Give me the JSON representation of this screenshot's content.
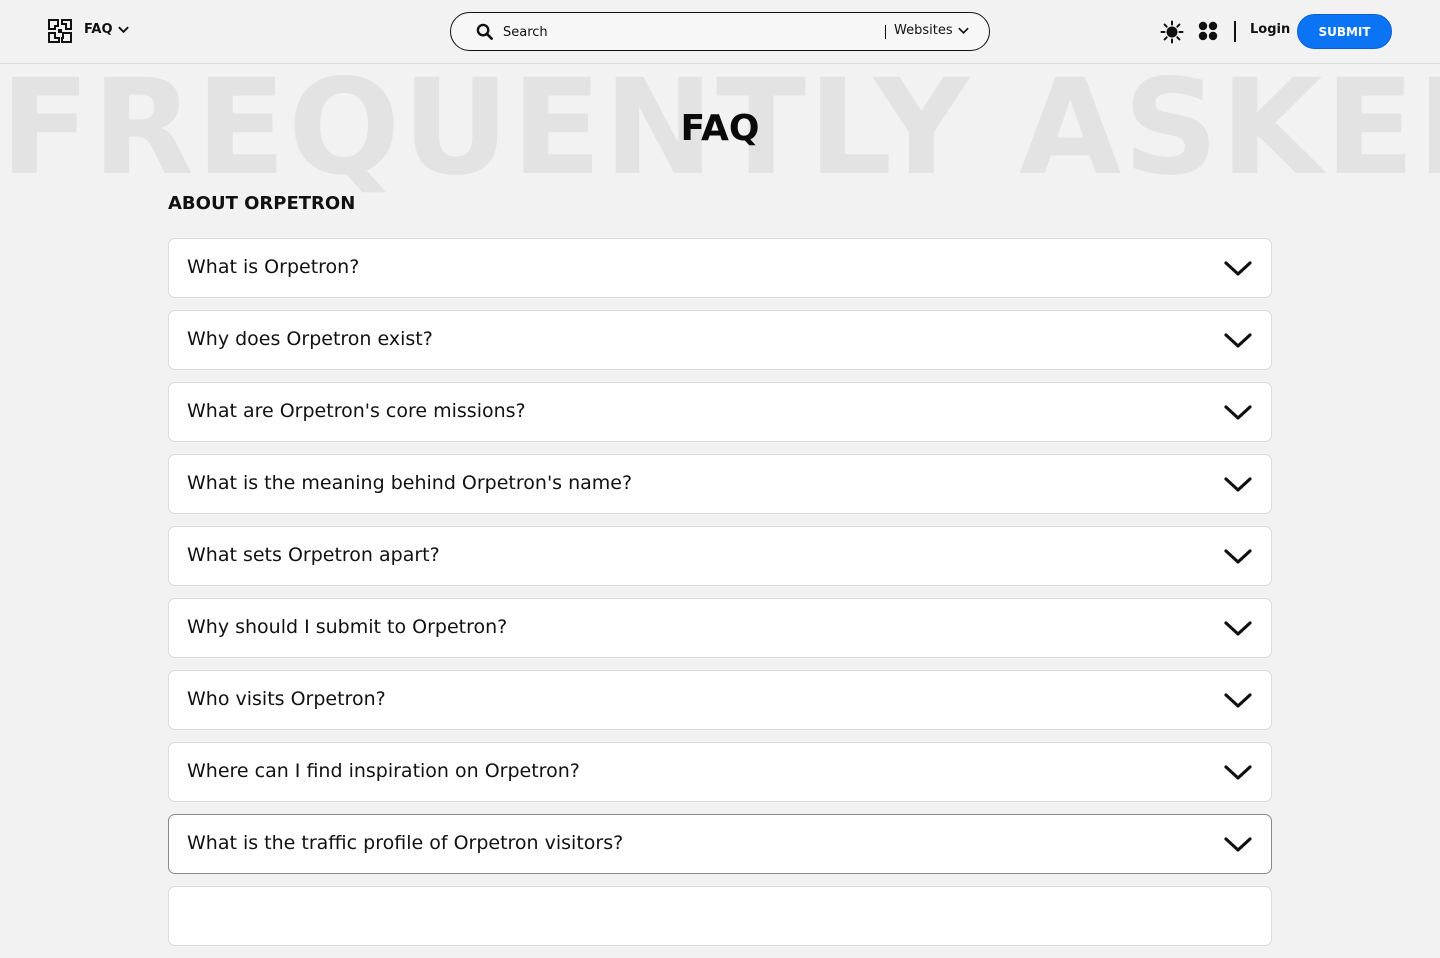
{
  "header": {
    "nav_label": "FAQ",
    "search_placeholder": "Search",
    "search_type": "Websites",
    "login_label": "Login",
    "submit_label": "SUBMIT"
  },
  "hero": {
    "background_text": "FREQUENTLY ASKED Q",
    "title": "FAQ"
  },
  "section": {
    "heading": "ABOUT ORPETRON"
  },
  "faq": [
    {
      "question": "What is Orpetron?"
    },
    {
      "question": "Why does Orpetron exist?"
    },
    {
      "question": "What are Orpetron's core missions?"
    },
    {
      "question": "What is the meaning behind Orpetron's name?"
    },
    {
      "question": "What sets Orpetron apart?"
    },
    {
      "question": "Why should I submit to Orpetron?"
    },
    {
      "question": "Who visits Orpetron?"
    },
    {
      "question": "Where can I find inspiration on Orpetron?"
    },
    {
      "question": "What is the traffic profile of Orpetron visitors?"
    },
    {
      "question": ""
    }
  ],
  "colors": {
    "accent": "#0a74f5",
    "background": "#f2f2f2",
    "card": "#ffffff"
  },
  "icons": [
    "logo-icon",
    "chevron-down-icon",
    "search-icon",
    "sun-icon",
    "apps-grid-icon"
  ]
}
